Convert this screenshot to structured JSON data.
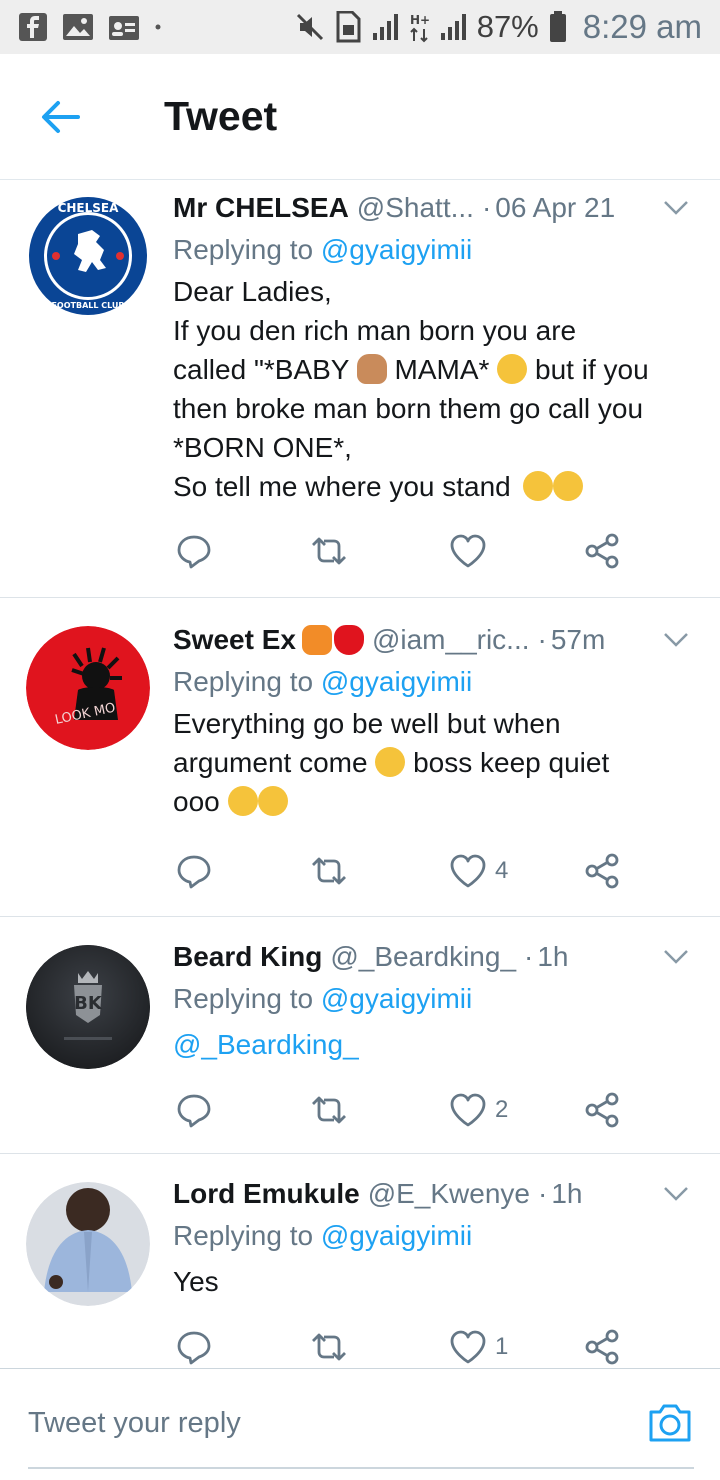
{
  "status_bar": {
    "battery_pct": "87%",
    "time": "8:29 am"
  },
  "header": {
    "title": "Tweet"
  },
  "tweets": [
    {
      "name": "Mr CHELSEA",
      "handle": "@Shatt...",
      "time": "06 Apr 21",
      "replying_label": "Replying to",
      "replying_to": "@gyaigyimii",
      "text_lines": [
        "Dear Ladies,",
        "If you den rich man born you are",
        "called \"*BABY",
        "MAMA*",
        "but if you",
        "then broke man born them go call you",
        "*BORN ONE*,",
        "So tell me where you stand"
      ],
      "likes": ""
    },
    {
      "name": "Sweet Ex",
      "handle": "@iam__ric...",
      "time": "57m",
      "replying_label": "Replying to",
      "replying_to": "@gyaigyimii",
      "text_lines": [
        "Everything go be well but when",
        "argument come",
        "boss keep quiet",
        "ooo"
      ],
      "likes": "4"
    },
    {
      "name": "Beard King",
      "handle": "@_Beardking_",
      "time": "1h",
      "replying_label": "Replying to",
      "replying_to": "@gyaigyimii",
      "text_lines": [
        "@_Beardking_"
      ],
      "likes": "2"
    },
    {
      "name": "Lord Emukule",
      "handle": "@E_Kwenye",
      "time": "1h",
      "replying_label": "Replying to",
      "replying_to": "@gyaigyimii",
      "text_lines": [
        "Yes"
      ],
      "likes": "1"
    }
  ],
  "compose": {
    "placeholder": "Tweet your reply"
  },
  "colors": {
    "accent": "#1da1f2",
    "secondary_text": "#657786",
    "primary_text": "#14171a"
  },
  "icons": [
    "facebook-icon",
    "gallery-icon",
    "contact-card-icon",
    "mute-icon",
    "sim-icon",
    "signal-icon",
    "battery-icon",
    "back-arrow-icon",
    "chevron-down-icon",
    "reply-icon",
    "retweet-icon",
    "heart-icon",
    "share-icon",
    "camera-icon"
  ]
}
